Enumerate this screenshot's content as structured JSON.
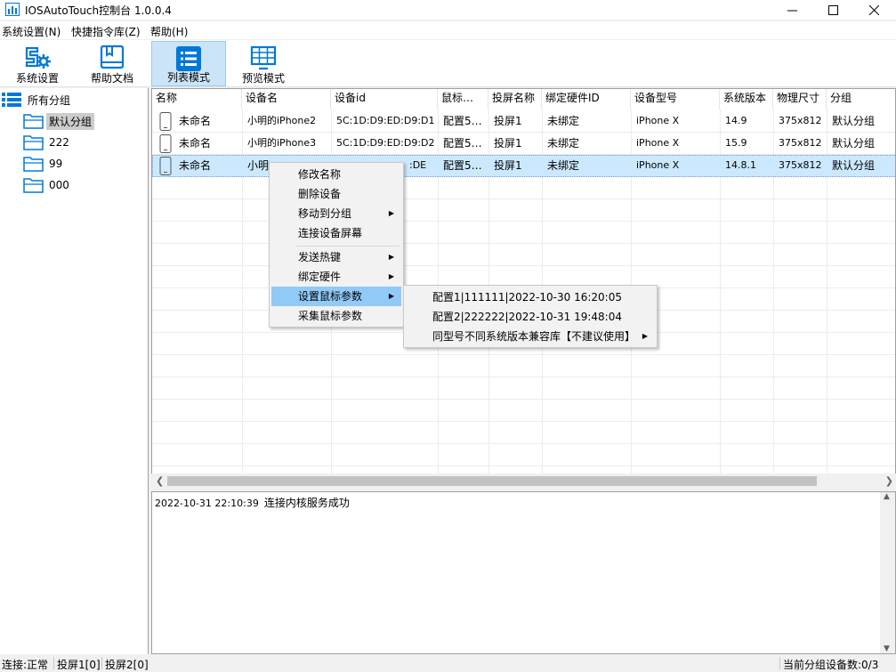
{
  "window": {
    "title": "IOSAutoTouch控制台 1.0.0.4",
    "accent": "#0078d7"
  },
  "menubar": [
    "系统设置(N)",
    "快捷指令库(Z)",
    "帮助(H)"
  ],
  "toolbar": {
    "settings": "系统设置",
    "help": "帮助文档",
    "list": "列表模式",
    "preview": "预览模式"
  },
  "tree": {
    "root": "所有分组",
    "groups": [
      "默认分组",
      "222",
      "99",
      "000"
    ]
  },
  "grid": {
    "headers": [
      "名称",
      "设备名",
      "设备id",
      "鼠标…",
      "投屏名称",
      "绑定硬件ID",
      "设备型号",
      "系统版本",
      "物理尺寸",
      "分组"
    ],
    "rows": [
      [
        "未命名",
        "小明的iPhone2",
        "5C:1D:D9:ED:D9:D1",
        "配置5…",
        "投屏1",
        "未绑定",
        "iPhone X",
        "14.9",
        "375x812",
        "默认分组"
      ],
      [
        "未命名",
        "小明的iPhone3",
        "5C:1D:D9:ED:D9:D2",
        "配置5…",
        "投屏1",
        "未绑定",
        "iPhone X",
        "15.9",
        "375x812",
        "默认分组"
      ],
      [
        "未命名",
        "小明",
        ":DE",
        "配置5…",
        "投屏1",
        "未绑定",
        "iPhone X",
        "14.8.1",
        "375x812",
        "默认分组"
      ]
    ]
  },
  "context_menu": {
    "items": [
      "修改名称",
      "删除设备",
      "移动到分组",
      "连接设备屏幕",
      "发送热键",
      "绑定硬件",
      "设置鼠标参数",
      "采集鼠标参数"
    ],
    "submenu": [
      "配置1|111111|2022-10-30 16:20:05",
      "配置2|222222|2022-10-31 19:48:04",
      "同型号不同系统版本兼容库【不建议使用】"
    ]
  },
  "log": {
    "timestamp": "2022-10-31 22:10:39",
    "message": "连接内核服务成功"
  },
  "status": {
    "connection": "连接:正常",
    "screen1": "投屏1[0]",
    "screen2": "投屏2[0]",
    "device_count": "当前分组设备数:0/3"
  }
}
